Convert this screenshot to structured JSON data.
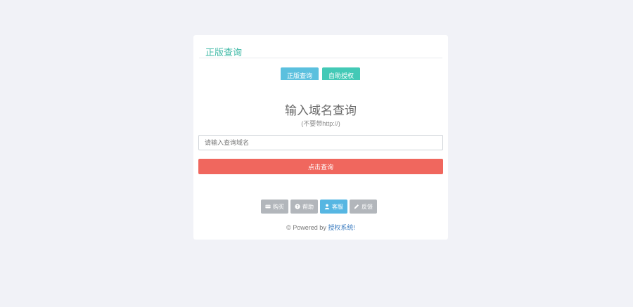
{
  "card": {
    "title": "正版查询"
  },
  "tabs": [
    {
      "label": "正版查询"
    },
    {
      "label": "自助授权"
    }
  ],
  "query": {
    "headline": "输入域名查询",
    "subline": "(不要带http://)",
    "placeholder": "请输入查询域名",
    "value": "",
    "submit_label": "点击查询"
  },
  "footer": {
    "buttons": [
      {
        "label": "购买",
        "icon": "card-icon"
      },
      {
        "label": "帮助",
        "icon": "question-icon"
      },
      {
        "label": "客服",
        "icon": "user-icon"
      },
      {
        "label": "反馈",
        "icon": "pencil-icon"
      }
    ],
    "powered_prefix": "© Powered by ",
    "powered_link": "授权系统!"
  },
  "colors": {
    "background": "#f1f2f7",
    "title": "#3fb9a6",
    "tab_query": "#5bc0de",
    "tab_auth": "#43c9b6",
    "submit": "#f0675e",
    "footer_button": "#b2b6bb",
    "service_button": "#56b6e2",
    "link": "#3a7bbf"
  }
}
